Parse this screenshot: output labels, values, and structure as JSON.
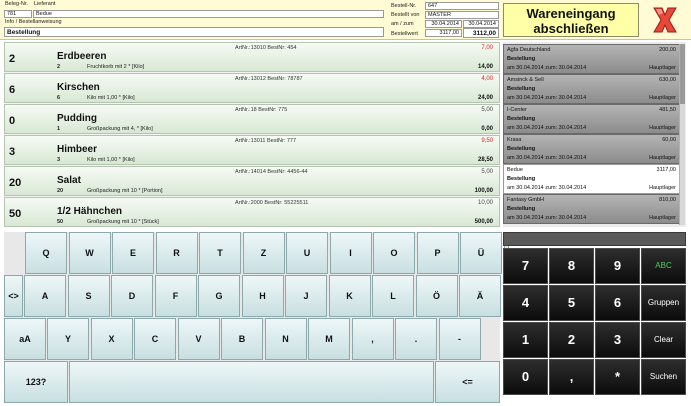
{
  "header": {
    "beleg_label": "Beleg-Nr.",
    "lieferant_label": "Lieferant",
    "beleg_nr": "781",
    "lieferant": "Bedue",
    "info_label": "Info / Bestellanweisung",
    "info_value": "Bestellung",
    "bestell_nr_label": "Bestell-Nr.",
    "bestell_nr": "647",
    "bestellt_von_label": "Bestellt von",
    "bestellt_von": "MASTER",
    "am_zum_label": "am / zum",
    "am": "30.04.2014",
    "zum": "30.04.2014",
    "bestellwert_label": "Bestellwert",
    "bestellwert_1": "3117,00",
    "bestellwert_2": "3112,00"
  },
  "actions": {
    "wareneingang_line1": "Wareneingang",
    "wareneingang_line2": "abschließen",
    "close_icon": "close-x-icon"
  },
  "items": [
    {
      "art": "ArtNr.:13010  BestNr: 454",
      "price": "7,00",
      "price_red": true,
      "qty": "2",
      "name": "Erdbeeren",
      "sub_qty": "2",
      "sub_text": "Fruchtkorb mit 2  * [Kilo]",
      "total": "14,00"
    },
    {
      "art": "ArtNr.:13012  BestNr: 78787",
      "price": "4,00",
      "price_red": true,
      "qty": "6",
      "name": "Kirschen",
      "sub_qty": "6",
      "sub_text": "Kilo mit 1,00  * [Kilo]",
      "total": "24,00"
    },
    {
      "art": "ArtNr.:18  BestNr: 775",
      "price": "5,00",
      "price_red": false,
      "qty": "0",
      "name": "Pudding",
      "sub_qty": "1",
      "sub_text": "Großpackung mit 4,  * [Kilo]",
      "total": "0,00"
    },
    {
      "art": "ArtNr.:13011  BestNr: 777",
      "price": "9,50",
      "price_red": true,
      "qty": "3",
      "name": "Himbeer",
      "sub_qty": "3",
      "sub_text": "Kilo mit 1,00  * [Kilo]",
      "total": "28,50"
    },
    {
      "art": "ArtNr.:14014  BestNr: 4456-44",
      "price": "5,00",
      "price_red": false,
      "qty": "20",
      "name": "Salat",
      "sub_qty": "20",
      "sub_text": "Großpackung mit 10  * [Portion]",
      "total": "100,00"
    },
    {
      "art": "ArtNr.:2000  BestNr: 55225511",
      "price": "10,00",
      "price_red": false,
      "qty": "50",
      "name": "1/2 Hähnchen",
      "sub_qty": "50",
      "sub_text": "Großpackung mit 10  * [Stück]",
      "total": "500,00"
    }
  ],
  "suppliers": [
    {
      "name": "Agfa Deutschland",
      "amount": "200,00",
      "type": "Bestellung",
      "dates": "am 30.04.2014 zum: 30.04.2014",
      "location": "Hauptlager",
      "selected": false
    },
    {
      "name": "Amsinck & Sell",
      "amount": "630,00",
      "type": "Bestellung",
      "dates": "am 30.04.2014 zum: 30.04.2014",
      "location": "Hauptlager",
      "selected": false
    },
    {
      "name": "I-Center",
      "amount": "481,50",
      "type": "Bestellung",
      "dates": "am 30.04.2014 zum: 30.04.2014",
      "location": "Hauptlager",
      "selected": false
    },
    {
      "name": "Krasa",
      "amount": "60,00",
      "type": "Bestellung",
      "dates": "am 30.04.2014 zum: 30.04.2014",
      "location": "Hauptlager",
      "selected": false
    },
    {
      "name": "Bedue",
      "amount": "3117,00",
      "type": "Bestellung",
      "dates": "am 30.04.2014 zum: 30.04.2014",
      "location": "Hauptlager",
      "selected": true
    },
    {
      "name": "Fantasy GmbH",
      "amount": "810,00",
      "type": "Bestellung",
      "dates": "am 30.04.2014 zum: 30.04.2014",
      "location": "Hauptlager",
      "selected": false
    }
  ],
  "keyboard": {
    "row1": [
      "Q",
      "W",
      "E",
      "R",
      "T",
      "Z",
      "U",
      "I",
      "O",
      "P",
      "Ü",
      "´"
    ],
    "row2": [
      "<>",
      "A",
      "S",
      "D",
      "F",
      "G",
      "H",
      "J",
      "K",
      "L",
      "Ö",
      "Ä"
    ],
    "row3": [
      "aA",
      "Y",
      "X",
      "C",
      "V",
      "B",
      "N",
      "M",
      ",",
      ".",
      "-"
    ],
    "mode_key": "123?",
    "space_key": "",
    "backspace_key": "<="
  },
  "numpad": {
    "rows": [
      [
        "7",
        "8",
        "9"
      ],
      [
        "4",
        "5",
        "6"
      ],
      [
        "1",
        "2",
        "3"
      ],
      [
        "0",
        ",",
        "*"
      ]
    ],
    "side": [
      "ABC",
      "Gruppen",
      "Clear",
      "Suchen"
    ]
  },
  "colors": {
    "header_bg": "#fffbd5",
    "accent_red": "#e02020",
    "abc_green": "#4ecf5c"
  }
}
